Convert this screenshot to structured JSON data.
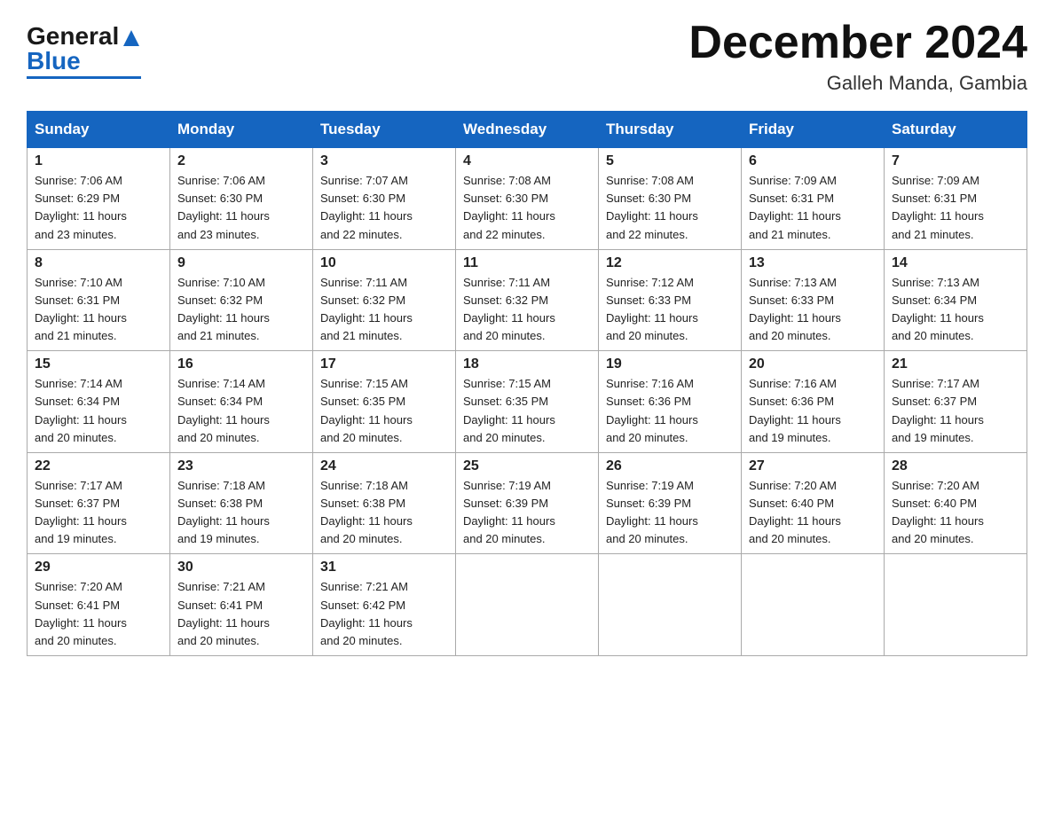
{
  "header": {
    "month_title": "December 2024",
    "location": "Galleh Manda, Gambia",
    "logo_general": "General",
    "logo_blue": "Blue"
  },
  "days_of_week": [
    "Sunday",
    "Monday",
    "Tuesday",
    "Wednesday",
    "Thursday",
    "Friday",
    "Saturday"
  ],
  "weeks": [
    [
      {
        "day": "1",
        "sunrise": "7:06 AM",
        "sunset": "6:29 PM",
        "daylight": "11 hours and 23 minutes."
      },
      {
        "day": "2",
        "sunrise": "7:06 AM",
        "sunset": "6:30 PM",
        "daylight": "11 hours and 23 minutes."
      },
      {
        "day": "3",
        "sunrise": "7:07 AM",
        "sunset": "6:30 PM",
        "daylight": "11 hours and 22 minutes."
      },
      {
        "day": "4",
        "sunrise": "7:08 AM",
        "sunset": "6:30 PM",
        "daylight": "11 hours and 22 minutes."
      },
      {
        "day": "5",
        "sunrise": "7:08 AM",
        "sunset": "6:30 PM",
        "daylight": "11 hours and 22 minutes."
      },
      {
        "day": "6",
        "sunrise": "7:09 AM",
        "sunset": "6:31 PM",
        "daylight": "11 hours and 21 minutes."
      },
      {
        "day": "7",
        "sunrise": "7:09 AM",
        "sunset": "6:31 PM",
        "daylight": "11 hours and 21 minutes."
      }
    ],
    [
      {
        "day": "8",
        "sunrise": "7:10 AM",
        "sunset": "6:31 PM",
        "daylight": "11 hours and 21 minutes."
      },
      {
        "day": "9",
        "sunrise": "7:10 AM",
        "sunset": "6:32 PM",
        "daylight": "11 hours and 21 minutes."
      },
      {
        "day": "10",
        "sunrise": "7:11 AM",
        "sunset": "6:32 PM",
        "daylight": "11 hours and 21 minutes."
      },
      {
        "day": "11",
        "sunrise": "7:11 AM",
        "sunset": "6:32 PM",
        "daylight": "11 hours and 20 minutes."
      },
      {
        "day": "12",
        "sunrise": "7:12 AM",
        "sunset": "6:33 PM",
        "daylight": "11 hours and 20 minutes."
      },
      {
        "day": "13",
        "sunrise": "7:13 AM",
        "sunset": "6:33 PM",
        "daylight": "11 hours and 20 minutes."
      },
      {
        "day": "14",
        "sunrise": "7:13 AM",
        "sunset": "6:34 PM",
        "daylight": "11 hours and 20 minutes."
      }
    ],
    [
      {
        "day": "15",
        "sunrise": "7:14 AM",
        "sunset": "6:34 PM",
        "daylight": "11 hours and 20 minutes."
      },
      {
        "day": "16",
        "sunrise": "7:14 AM",
        "sunset": "6:34 PM",
        "daylight": "11 hours and 20 minutes."
      },
      {
        "day": "17",
        "sunrise": "7:15 AM",
        "sunset": "6:35 PM",
        "daylight": "11 hours and 20 minutes."
      },
      {
        "day": "18",
        "sunrise": "7:15 AM",
        "sunset": "6:35 PM",
        "daylight": "11 hours and 20 minutes."
      },
      {
        "day": "19",
        "sunrise": "7:16 AM",
        "sunset": "6:36 PM",
        "daylight": "11 hours and 20 minutes."
      },
      {
        "day": "20",
        "sunrise": "7:16 AM",
        "sunset": "6:36 PM",
        "daylight": "11 hours and 19 minutes."
      },
      {
        "day": "21",
        "sunrise": "7:17 AM",
        "sunset": "6:37 PM",
        "daylight": "11 hours and 19 minutes."
      }
    ],
    [
      {
        "day": "22",
        "sunrise": "7:17 AM",
        "sunset": "6:37 PM",
        "daylight": "11 hours and 19 minutes."
      },
      {
        "day": "23",
        "sunrise": "7:18 AM",
        "sunset": "6:38 PM",
        "daylight": "11 hours and 19 minutes."
      },
      {
        "day": "24",
        "sunrise": "7:18 AM",
        "sunset": "6:38 PM",
        "daylight": "11 hours and 20 minutes."
      },
      {
        "day": "25",
        "sunrise": "7:19 AM",
        "sunset": "6:39 PM",
        "daylight": "11 hours and 20 minutes."
      },
      {
        "day": "26",
        "sunrise": "7:19 AM",
        "sunset": "6:39 PM",
        "daylight": "11 hours and 20 minutes."
      },
      {
        "day": "27",
        "sunrise": "7:20 AM",
        "sunset": "6:40 PM",
        "daylight": "11 hours and 20 minutes."
      },
      {
        "day": "28",
        "sunrise": "7:20 AM",
        "sunset": "6:40 PM",
        "daylight": "11 hours and 20 minutes."
      }
    ],
    [
      {
        "day": "29",
        "sunrise": "7:20 AM",
        "sunset": "6:41 PM",
        "daylight": "11 hours and 20 minutes."
      },
      {
        "day": "30",
        "sunrise": "7:21 AM",
        "sunset": "6:41 PM",
        "daylight": "11 hours and 20 minutes."
      },
      {
        "day": "31",
        "sunrise": "7:21 AM",
        "sunset": "6:42 PM",
        "daylight": "11 hours and 20 minutes."
      },
      null,
      null,
      null,
      null
    ]
  ],
  "labels": {
    "sunrise": "Sunrise:",
    "sunset": "Sunset:",
    "daylight": "Daylight:"
  },
  "colors": {
    "header_bg": "#1565c0",
    "accent": "#1565c0"
  }
}
